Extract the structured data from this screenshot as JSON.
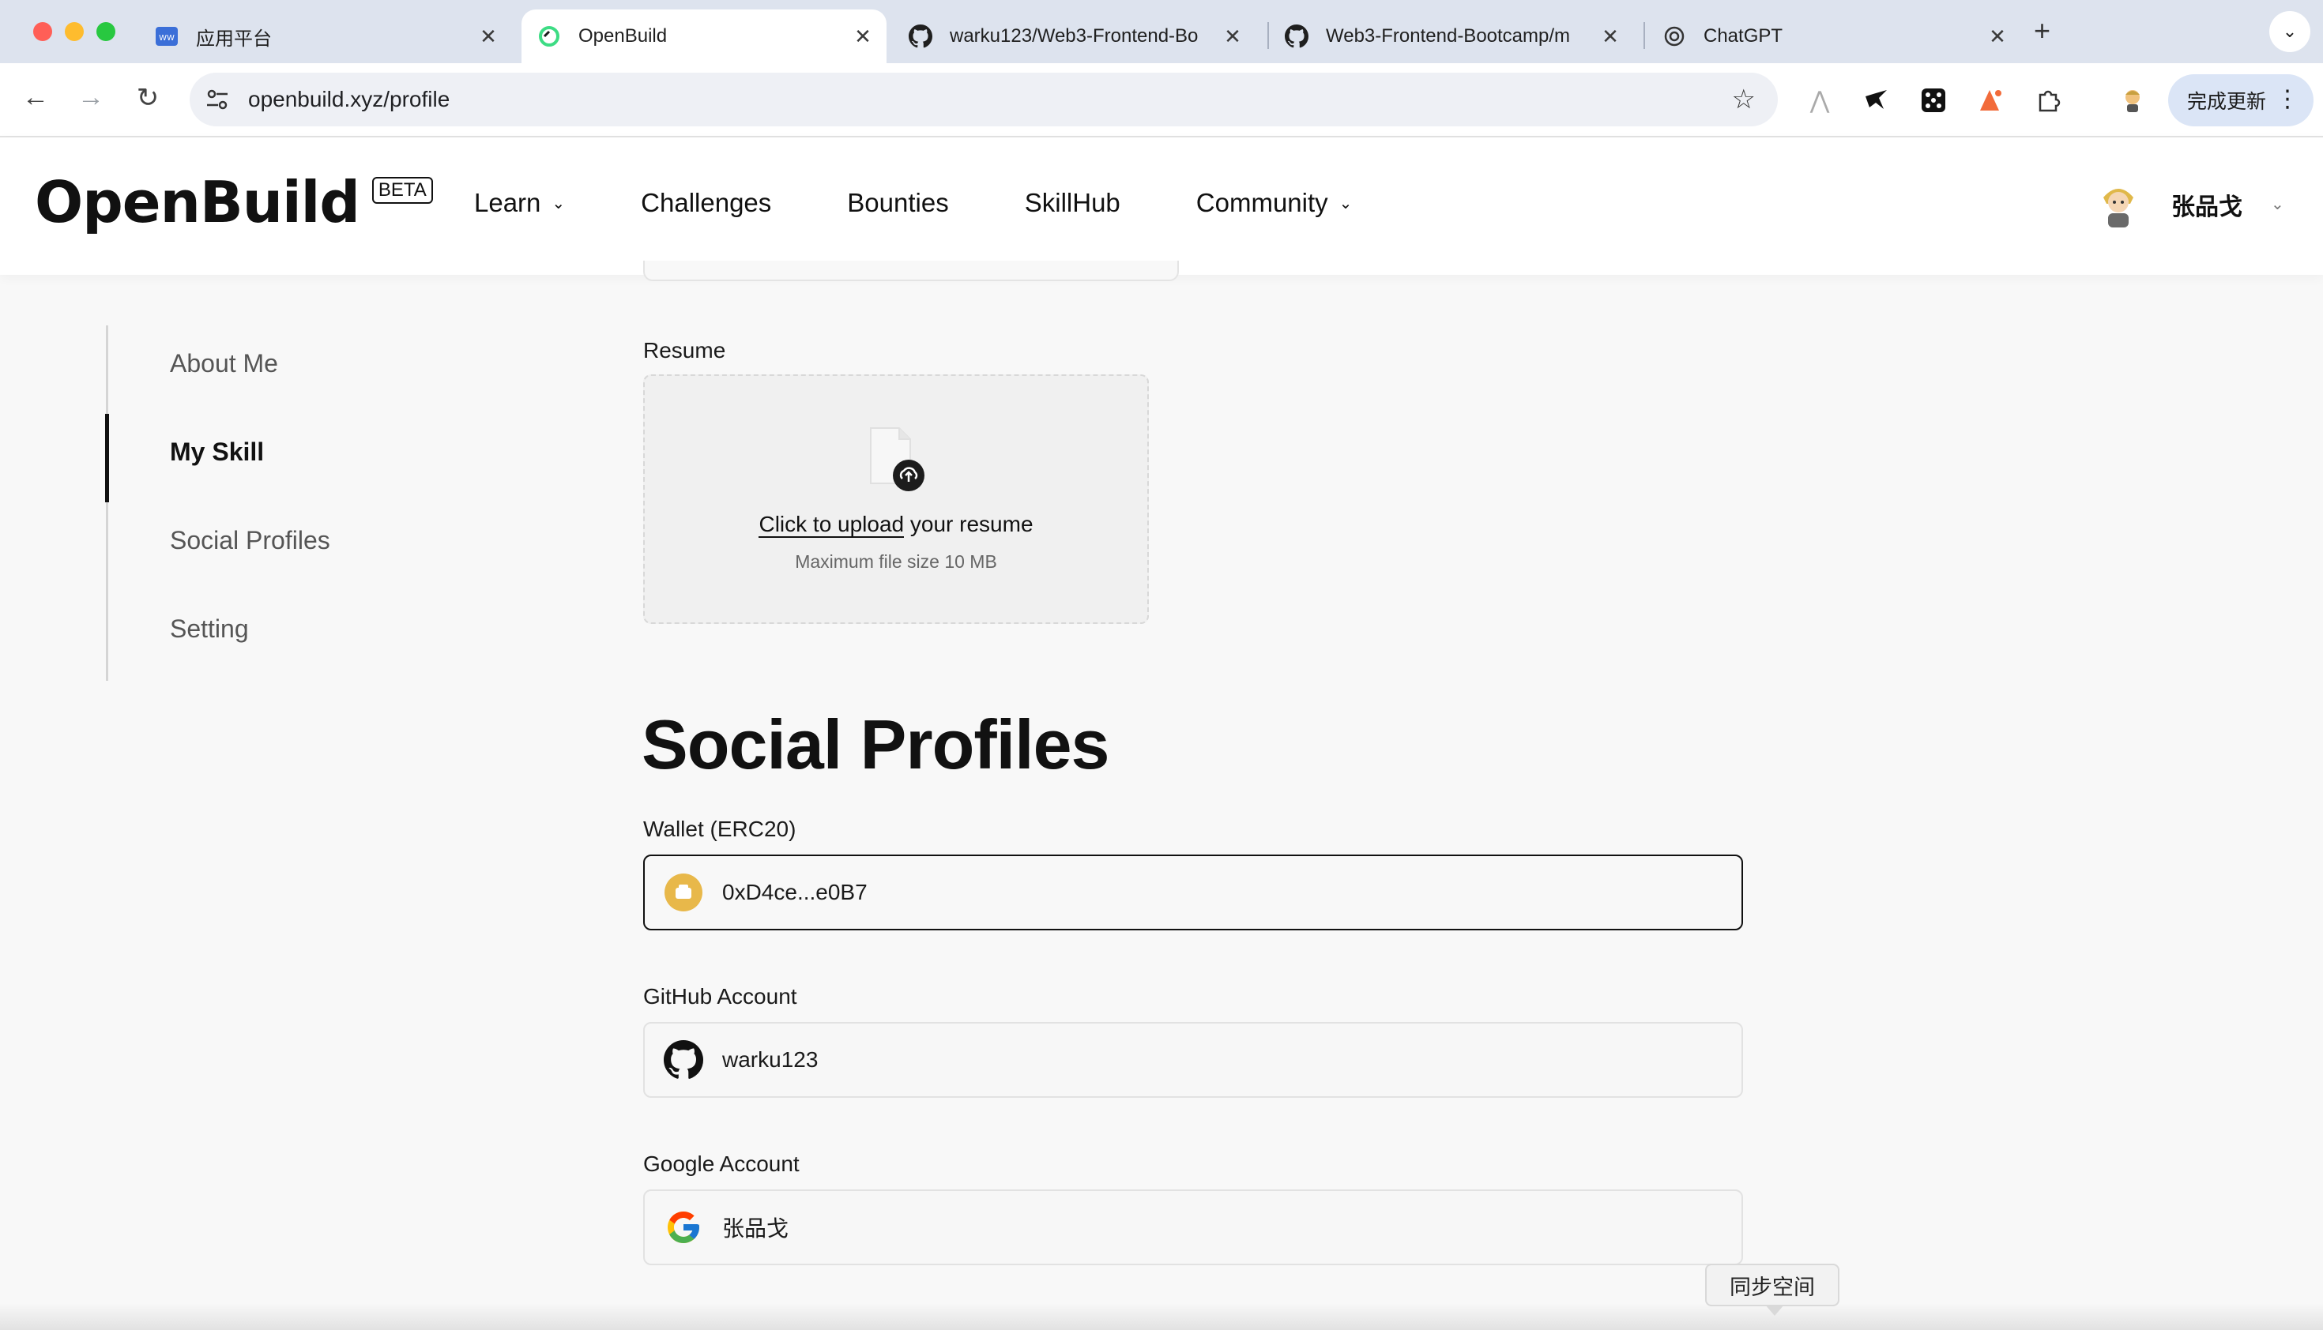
{
  "browser": {
    "tabs": [
      {
        "title": "应用平台",
        "icon": "app-platform-icon",
        "close": "✕"
      },
      {
        "title": "OpenBuild",
        "icon": "openbuild-icon",
        "close": "✕"
      },
      {
        "title": "warku123/Web3-Frontend-Bo",
        "icon": "github-icon",
        "close": "✕"
      },
      {
        "title": "Web3-Frontend-Bootcamp/m",
        "icon": "github-icon",
        "close": "✕"
      },
      {
        "title": "ChatGPT",
        "icon": "chatgpt-icon",
        "close": "✕"
      }
    ],
    "new_tab": "+",
    "url": "openbuild.xyz/profile",
    "update_button": "完成更新"
  },
  "header": {
    "logo": "OpenBuild",
    "beta": "BETA",
    "nav": [
      {
        "label": "Learn",
        "dropdown": true
      },
      {
        "label": "Challenges",
        "dropdown": false
      },
      {
        "label": "Bounties",
        "dropdown": false
      },
      {
        "label": "SkillHub",
        "dropdown": false
      },
      {
        "label": "Community",
        "dropdown": true
      }
    ],
    "user_name": "张品戈"
  },
  "sidebar": {
    "items": [
      {
        "label": "About Me",
        "active": false
      },
      {
        "label": "My Skill",
        "active": true
      },
      {
        "label": "Social Profiles",
        "active": false
      },
      {
        "label": "Setting",
        "active": false
      }
    ]
  },
  "resume": {
    "label": "Resume",
    "cta_link": "Click to upload",
    "cta_rest": " your resume",
    "hint": "Maximum file size 10 MB"
  },
  "social": {
    "title": "Social Profiles",
    "wallet": {
      "label": "Wallet (ERC20)",
      "value": "0xD4ce...e0B7"
    },
    "github": {
      "label": "GitHub Account",
      "value": "warku123"
    },
    "google": {
      "label": "Google Account",
      "value": "张品戈"
    }
  },
  "tooltip": "同步空间",
  "colors": {
    "wallet_yellow": "#e8b84a",
    "accent": "#111111",
    "openbuild_green": "#3ddc84"
  }
}
